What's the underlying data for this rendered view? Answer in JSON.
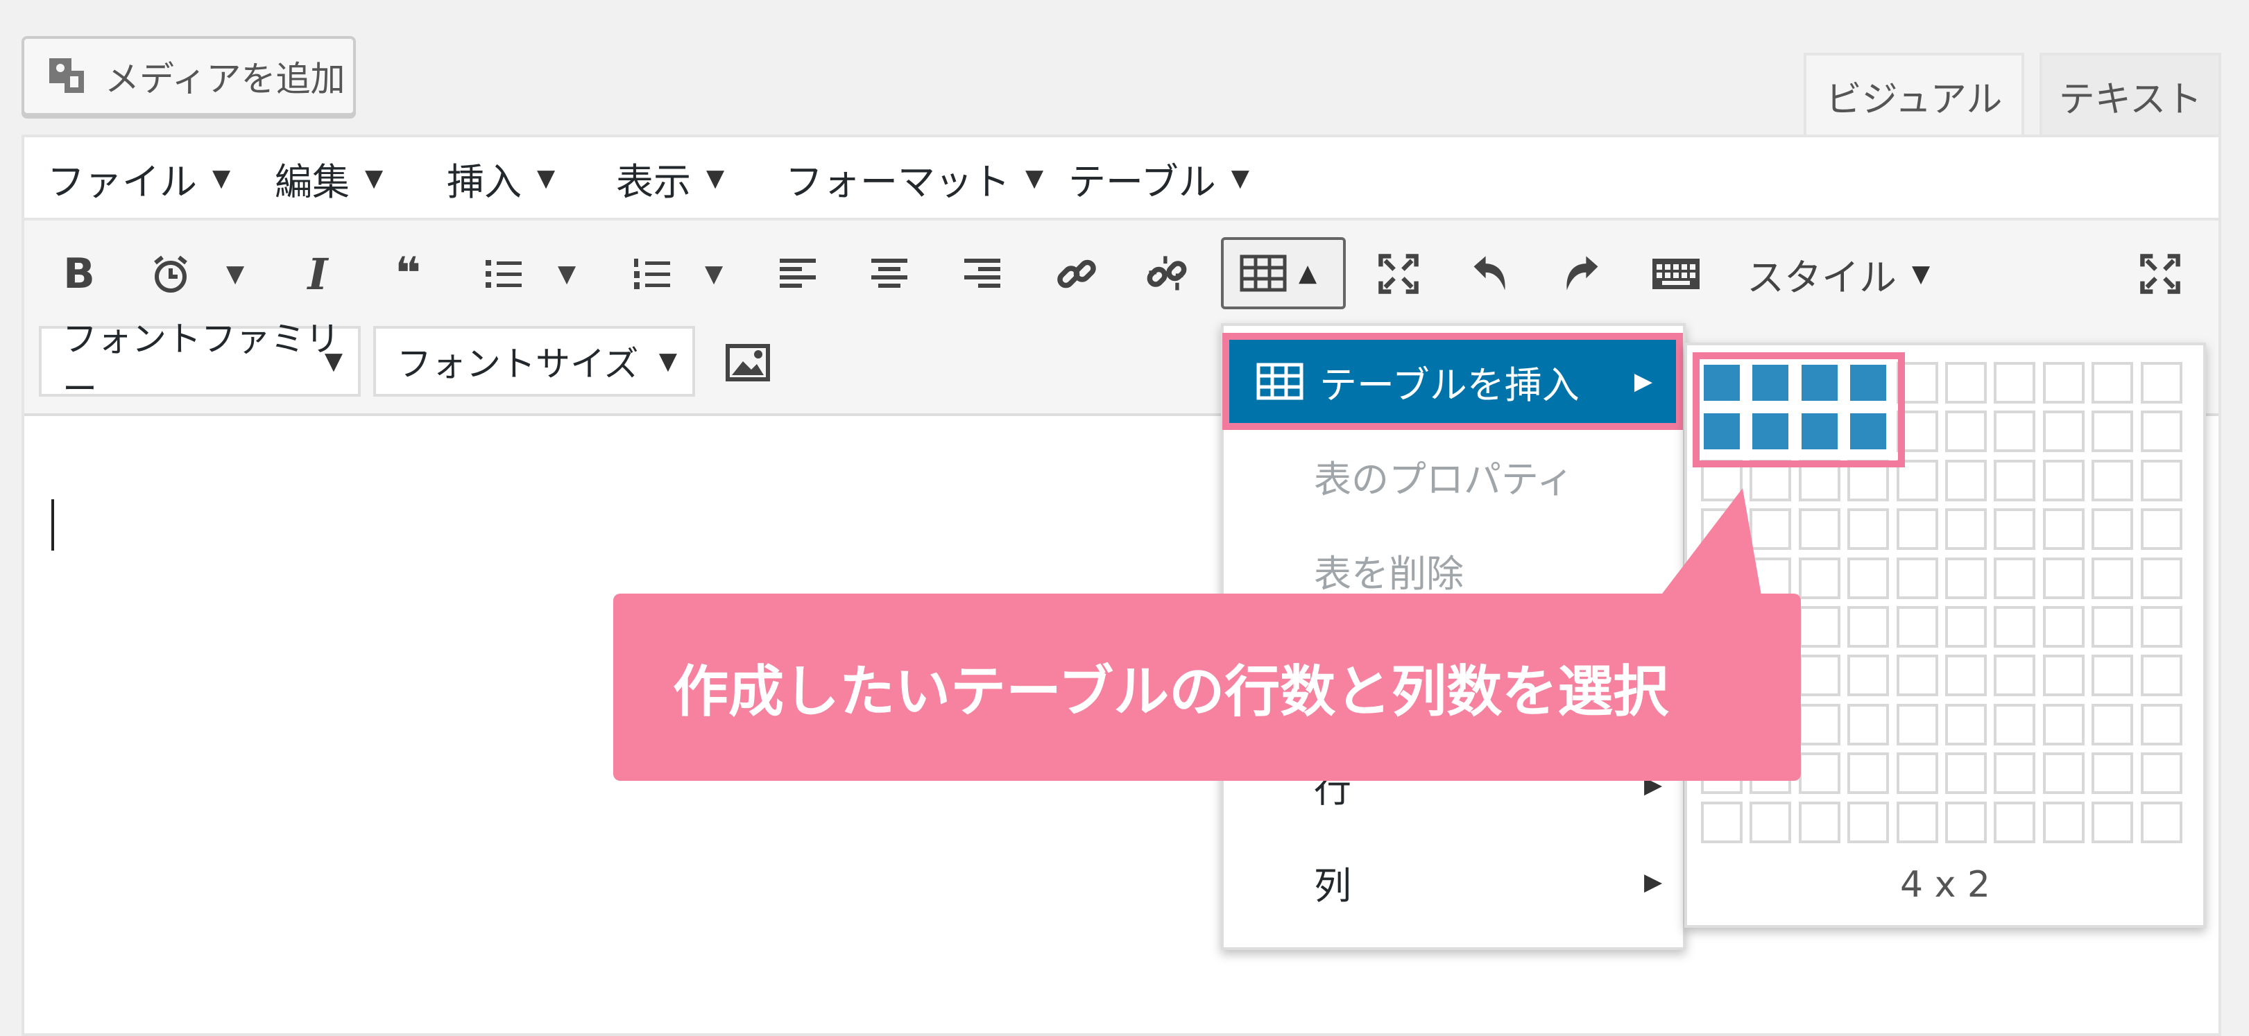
{
  "media_button": {
    "label": "メディアを追加",
    "icon": "media-icon"
  },
  "tabs": [
    {
      "label": "ビジュアル",
      "active": true
    },
    {
      "label": "テキスト",
      "active": false
    }
  ],
  "menubar": {
    "items": [
      {
        "label": "ファイル"
      },
      {
        "label": "編集"
      },
      {
        "label": "挿入"
      },
      {
        "label": "表示"
      },
      {
        "label": "フォーマット"
      },
      {
        "label": "テーブル"
      }
    ],
    "dropdown_indicator": "▼"
  },
  "toolbar": {
    "icons": [
      "bold-icon",
      "clock-icon",
      "italic-icon",
      "blockquote-icon",
      "bullet-list-icon",
      "numbered-list-icon",
      "align-left-icon",
      "align-center-icon",
      "align-right-icon",
      "link-icon",
      "unlink-icon",
      "table-icon",
      "fullscreen-icon",
      "undo-icon",
      "redo-icon",
      "keyboard-icon",
      "expand-icon"
    ],
    "bold_glyph": "B",
    "italic_glyph": "I",
    "quote_glyph": "❝",
    "style_label": "スタイル",
    "caret": "▼",
    "caret_up": "▲",
    "font_family_label": "フォントファミリー",
    "font_size_label": "フォントサイズ"
  },
  "table_menu": {
    "insert_label": "テーブルを挿入",
    "properties_label": "表のプロパティ",
    "delete_label": "表を削除",
    "row_label": "行",
    "column_label": "列",
    "submenu_arrow": "▶"
  },
  "grid_picker": {
    "columns": 10,
    "rows": 10,
    "selected_columns": 4,
    "selected_rows": 2,
    "size_label": "4 x 2"
  },
  "callout": {
    "text": "作成したいテーブルの行数と列数を選択"
  },
  "colors": {
    "accent": "#0073aa",
    "highlight": "#f27a9c",
    "callout": "#f6829f",
    "selected_cell": "#2e8bc0"
  }
}
